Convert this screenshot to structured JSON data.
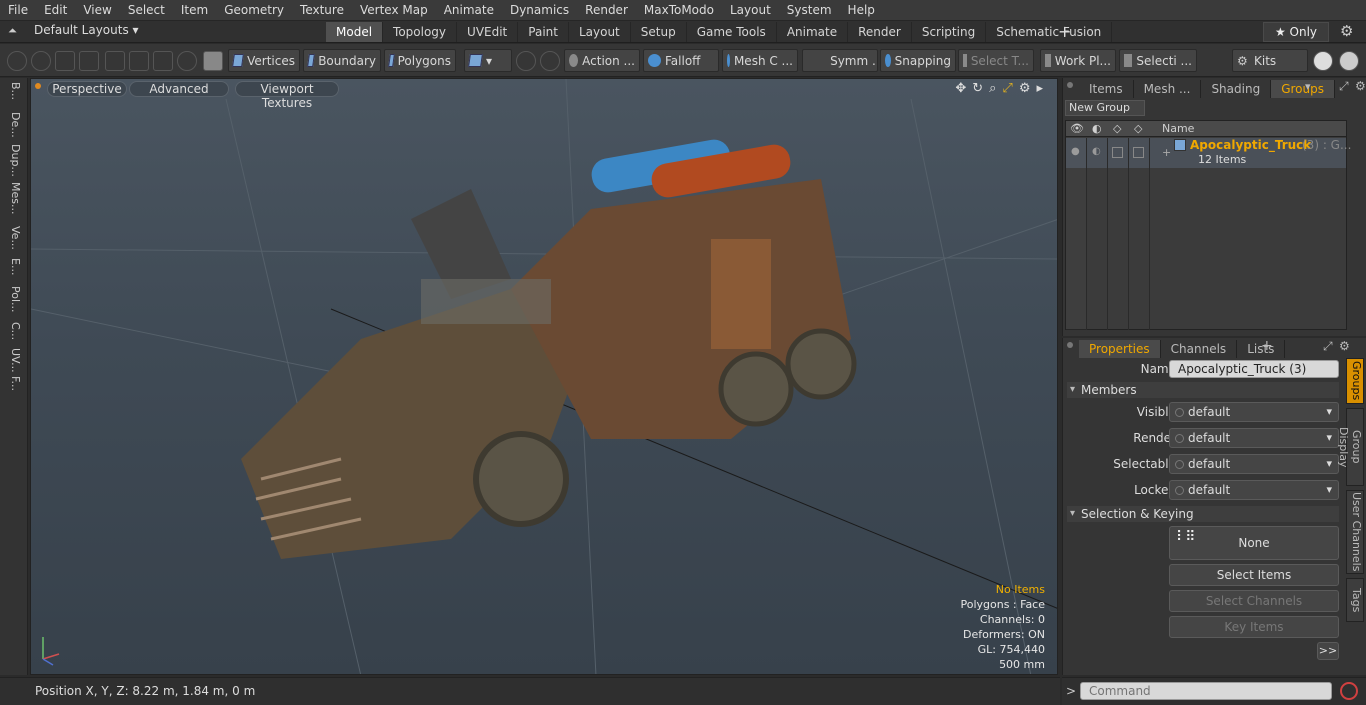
{
  "menu": [
    "File",
    "Edit",
    "View",
    "Select",
    "Item",
    "Geometry",
    "Texture",
    "Vertex Map",
    "Animate",
    "Dynamics",
    "Render",
    "MaxToModo",
    "Layout",
    "System",
    "Help"
  ],
  "layouts_label": "Default Layouts",
  "layout_tabs": [
    {
      "label": "Model",
      "active": true
    },
    {
      "label": "Topology"
    },
    {
      "label": "UVEdit"
    },
    {
      "label": "Paint"
    },
    {
      "label": "Layout"
    },
    {
      "label": "Setup"
    },
    {
      "label": "Game Tools"
    },
    {
      "label": "Animate"
    },
    {
      "label": "Render"
    },
    {
      "label": "Scripting"
    },
    {
      "label": "Schematic Fusion"
    }
  ],
  "only_label": "★ Only",
  "toolbar": {
    "vertices": "Vertices",
    "boundary": "Boundary",
    "polygons": "Polygons",
    "action": "Action",
    "falloff": "Falloff",
    "mesh_c": "Mesh C ...",
    "symm": "Symm ...",
    "snapping": "Snapping",
    "select_t": "Select T...",
    "work_pl": "Work Pl...",
    "selecti": "Selecti ...",
    "kits": "Kits"
  },
  "viewport": {
    "perspective": "Perspective",
    "advanced": "Advanced",
    "viewport_textures": "Viewport Textures",
    "overlay": [
      "No Items",
      "Polygons : Face",
      "Channels: 0",
      "Deformers: ON",
      "GL: 754,440",
      "500 mm"
    ]
  },
  "left_tools": [
    "B...",
    "De...",
    "Dup...",
    "Mes...",
    "Ve...",
    "E...",
    "Pol...",
    "C...",
    "UV...",
    "F..."
  ],
  "status_text": "Position X, Y, Z:   8.22 m, 1.84 m, 0 m",
  "groups_panel": {
    "tabs": [
      {
        "label": "Items"
      },
      {
        "label": "Mesh ..."
      },
      {
        "label": "Shading"
      },
      {
        "label": "Groups",
        "active": true
      }
    ],
    "new_group": "New Group",
    "name_header": "Name",
    "item_name": "Apocalyptic_Truck",
    "item_suffix": "(3) : G...",
    "item_count": "12 Items"
  },
  "properties": {
    "tabs": [
      {
        "label": "Properties",
        "active": true
      },
      {
        "label": "Channels"
      },
      {
        "label": "Lists"
      }
    ],
    "name_label": "Name",
    "name_value": "Apocalyptic_Truck (3)",
    "members_section": "Members",
    "rows": [
      {
        "label": "Visible",
        "value": "default"
      },
      {
        "label": "Render",
        "value": "default"
      },
      {
        "label": "Selectable",
        "value": "default"
      },
      {
        "label": "Locked",
        "value": "default"
      }
    ],
    "selection_section": "Selection & Keying",
    "none_btn": "None",
    "select_items": "Select Items",
    "select_channels": "Select Channels",
    "key_items": "Key Items",
    "more_btn": ">>",
    "side_tabs": [
      "Groups",
      "Group Display",
      "User Channels",
      "Tags"
    ]
  },
  "command_placeholder": "Command",
  "colors": {
    "accent": "#f0a800",
    "active_tab": "#505050"
  }
}
